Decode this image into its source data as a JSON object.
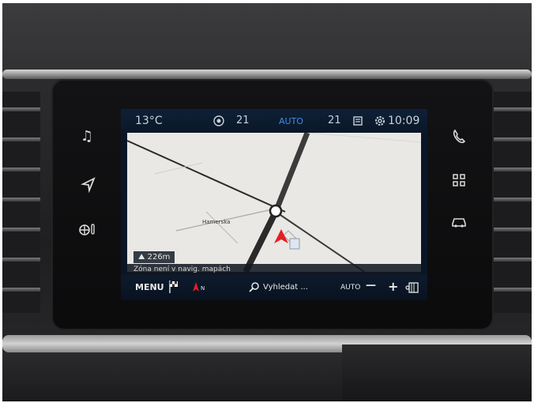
{
  "status": {
    "temp_left": "13°C",
    "fan_left": "21",
    "mode": "AUTO",
    "fan_right": "21",
    "time": "10:09"
  },
  "map": {
    "place_label": "Hamerska",
    "distance": "226m",
    "notice": "Zóna není v navig. mapách"
  },
  "bottom": {
    "menu": "MENU",
    "search": "Vyhledat ...",
    "auto": "AUTO",
    "minus": "—",
    "plus": "+"
  },
  "icons": [
    "music-icon",
    "navigation-icon",
    "climate-icon",
    "phone-icon",
    "apps-grid-icon",
    "car-icon"
  ]
}
